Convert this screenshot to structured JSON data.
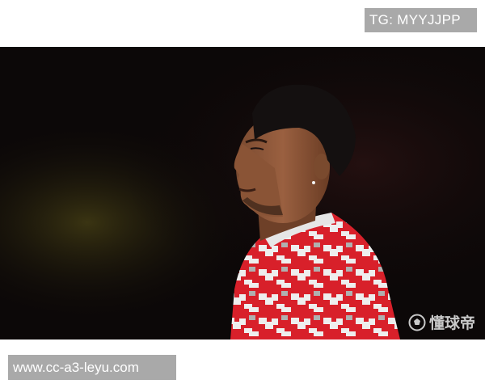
{
  "top_badge": {
    "text": "TG: MYYJJPP"
  },
  "photo": {
    "subject": "footballer-portrait",
    "watermark_logo_text": "懂球帝",
    "watermark_icon": "football-icon"
  },
  "bottom_badge": {
    "text": "www.cc-a3-leyu.com"
  },
  "colors": {
    "badge_bg": "#a9a9a9",
    "badge_text": "#ffffff",
    "photo_bg": "#0c0808",
    "jersey_red": "#d8202a",
    "jersey_white": "#eeeeee"
  }
}
